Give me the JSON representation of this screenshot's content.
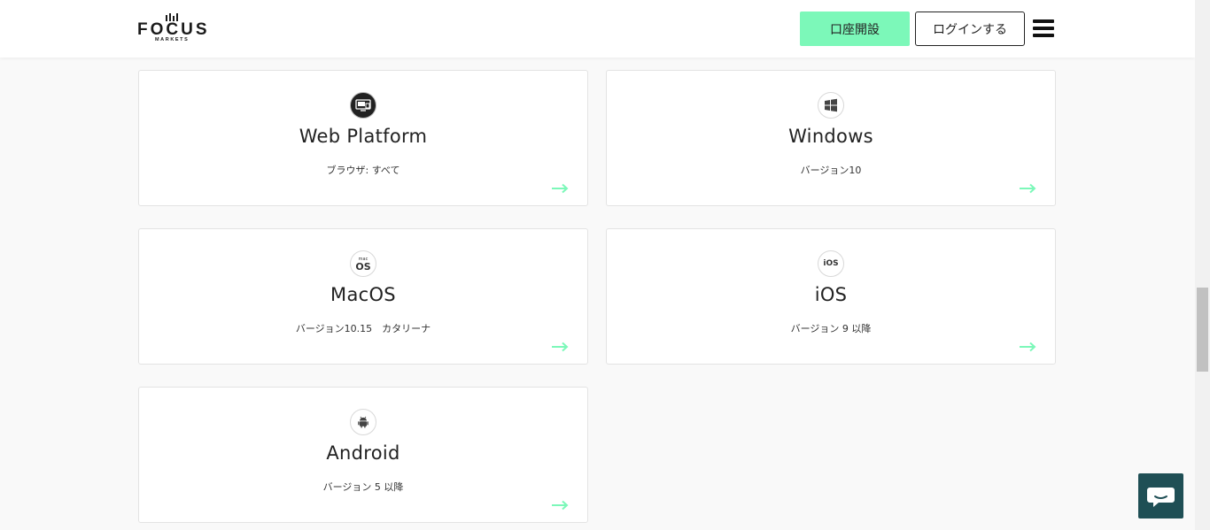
{
  "header": {
    "logo": {
      "text": "FOCUS",
      "sub": "MARKETS"
    },
    "open_account_label": "口座開設",
    "login_label": "ログインする"
  },
  "platforms": [
    {
      "title": "Web Platform",
      "subtitle": "ブラウザ: すべて",
      "icon": "monitor-icon"
    },
    {
      "title": "Windows",
      "subtitle": "バージョン10",
      "icon": "windows-icon"
    },
    {
      "title": "MacOS",
      "subtitle": "バージョン10.15　カタリーナ",
      "icon": "macos-icon",
      "icon_text_small": "mac",
      "icon_text": "OS"
    },
    {
      "title": "iOS",
      "subtitle": "バージョン 9 以降",
      "icon": "ios-icon",
      "icon_text": "iOS"
    },
    {
      "title": "Android",
      "subtitle": "バージョン 5 以降",
      "icon": "android-icon"
    }
  ],
  "colors": {
    "accent": "#7cf8b9",
    "arrow": "#7cf8b9",
    "chat_button": "#1f4f55"
  }
}
